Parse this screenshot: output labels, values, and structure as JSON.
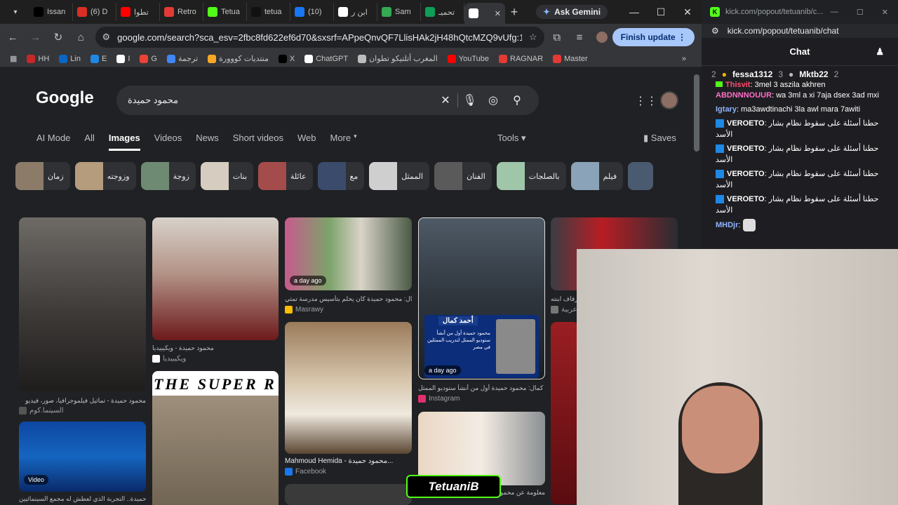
{
  "browser": {
    "tabs": [
      {
        "label": "Issan",
        "icon": "x-logo-icon",
        "color": "#000000"
      },
      {
        "label": "(6) D",
        "icon": "chrome-icon",
        "color": "#d93025"
      },
      {
        "label": "تطوا",
        "icon": "youtube-icon",
        "color": "#ff0000"
      },
      {
        "label": "Retro",
        "icon": "retro-icon",
        "color": "#e53935"
      },
      {
        "label": "Tetua",
        "icon": "kick-icon",
        "color": "#53fc18"
      },
      {
        "label": "tetua",
        "icon": "tiktok-icon",
        "color": "#111111"
      },
      {
        "label": "(10)",
        "icon": "facebook-icon",
        "color": "#1877f2"
      },
      {
        "label": "ابن ر",
        "icon": "wikipedia-icon",
        "color": "#ffffff"
      },
      {
        "label": "Sam",
        "icon": "maps-icon",
        "color": "#34a853"
      },
      {
        "label": "تحميـ",
        "icon": "sheets-icon",
        "color": "#0f9d58"
      },
      {
        "label": "",
        "icon": "google-icon",
        "color": "#ffffff",
        "active": true
      }
    ],
    "ask_gemini": "Ask Gemini",
    "url": "google.com/search?sca_esv=2fbc8fd622ef6d70&sxsrf=APpeQnvQF7LlisHAk2jH48hQtcMZQ9vUfg:17869260716...",
    "finish_update": "Finish update",
    "bookmarks": [
      {
        "label": "HH",
        "color": "#c62828"
      },
      {
        "label": "Lin",
        "color": "#0a66c2"
      },
      {
        "label": "E",
        "color": "#1e88e5"
      },
      {
        "label": "I",
        "color": "#ffffff"
      },
      {
        "label": "G",
        "color": "#ea4335"
      },
      {
        "label": "ترجمة",
        "color": "#4285f4"
      },
      {
        "label": "منتديات كووورة",
        "color": "#f9a825"
      },
      {
        "label": "X",
        "color": "#000000"
      },
      {
        "label": "ChatGPT",
        "color": "#ffffff"
      },
      {
        "label": "المغرب أتلتيكو تطوان",
        "color": "#bdbdbd"
      },
      {
        "label": "YouTube",
        "color": "#ff0000"
      },
      {
        "label": "RAGNAR",
        "color": "#e53935"
      },
      {
        "label": "Master",
        "color": "#e53935"
      }
    ]
  },
  "google": {
    "logo": "Google",
    "query": "محمود حميدة",
    "tabs": [
      "AI Mode",
      "All",
      "Images",
      "Videos",
      "News",
      "Short videos",
      "Web",
      "More"
    ],
    "active_tab": "Images",
    "tools": "Tools",
    "saves": "Saves",
    "chips": [
      "زمان",
      "وزوجته",
      "زوجة",
      "بنات",
      "عائلة",
      "مع",
      "الممثل",
      "الفنان",
      "بالصلجات",
      "فيلم"
    ],
    "results": [
      {
        "caption": "محمود حميدة - تماثيل فيلموجرافيا، صور، فيديو",
        "source": "السينما.كوم",
        "src_color": "#555555"
      },
      {
        "caption": "محمود حميدة - ويكيبيديا",
        "source": "ويكيبيديا",
        "src_color": "#ffffff"
      },
      {
        "caption": "أحمد كمال: محمود حميدة كان يحلم بتأسيس مدرسة تمثي...",
        "source": "Masrawy",
        "src_color": "#fbbc04",
        "badge": "a day ago"
      },
      {
        "caption": "أحمد كمال: محمود حميدة أول من أنشأ ستوديو الممثل",
        "source": "Instagram",
        "src_color": "#e1306c",
        "badge": "a day ago"
      },
      {
        "caption": "زفاف ابنته",
        "source": "عربية",
        "src_color": "#777777"
      },
      {
        "caption": "Mahmoud Hemida - محمود حميدة...",
        "source": "Facebook",
        "src_color": "#1877f2"
      },
      {
        "caption": "محمود حميدة.. التجربة الذي لعطش له مجمع السينمائيين",
        "source": "",
        "src_color": "#555555",
        "badge": "Video"
      },
      {
        "caption": "13 معلومة عن محمود",
        "source": "",
        "src_color": "#555555"
      }
    ],
    "banner_text": "THE SUPER R",
    "card_title": "أحمد كمال",
    "card_body": "محمود حميدة أول من أنشأ ستوديو الممثل لتدريب الممثلين في مصر"
  },
  "chat": {
    "url_short": "kick.com/popout/tetuanib/c...",
    "url": "kick.com/popout/tetuanib/chat",
    "title": "Chat",
    "leaderboard": [
      {
        "rank": "2",
        "name": "",
        "count": ""
      },
      {
        "rank": "",
        "name": "fessa1312",
        "count": "3"
      },
      {
        "rank": "",
        "name": "Mktb22",
        "count": "2"
      }
    ],
    "messages": [
      {
        "user": "Thisvit",
        "text": "3mel 3 aszila akhren",
        "color": "#ff4d6d"
      },
      {
        "user": "ABDNNNOUUR",
        "text": "wa 3ml a xi 7aja dsex 3ad mxi",
        "color": "#ff6ec7"
      },
      {
        "user": "Igtary",
        "text": "ma3awdtinachi 3la awl mara 7awiti",
        "color": "#8fb4ff"
      },
      {
        "user": "VEROETO",
        "text": "حطنا أسئلة على سقوط نظام بشار الأسد",
        "color": "#ffffff"
      },
      {
        "user": "VEROETO",
        "text": "حطنا أسئلة على سقوط نظام بشار الأسد",
        "color": "#ffffff"
      },
      {
        "user": "VEROETO",
        "text": "حطنا أسئلة على سقوط نظام بشار الأسد",
        "color": "#ffffff"
      },
      {
        "user": "VEROETO",
        "text": "حطنا أسئلة على سقوط نظام بشار الأسد",
        "color": "#ffffff"
      },
      {
        "user": "MHDjr",
        "text": "",
        "color": "#8fb4ff"
      }
    ]
  },
  "overlay": {
    "watermark": "TetuaniB"
  }
}
